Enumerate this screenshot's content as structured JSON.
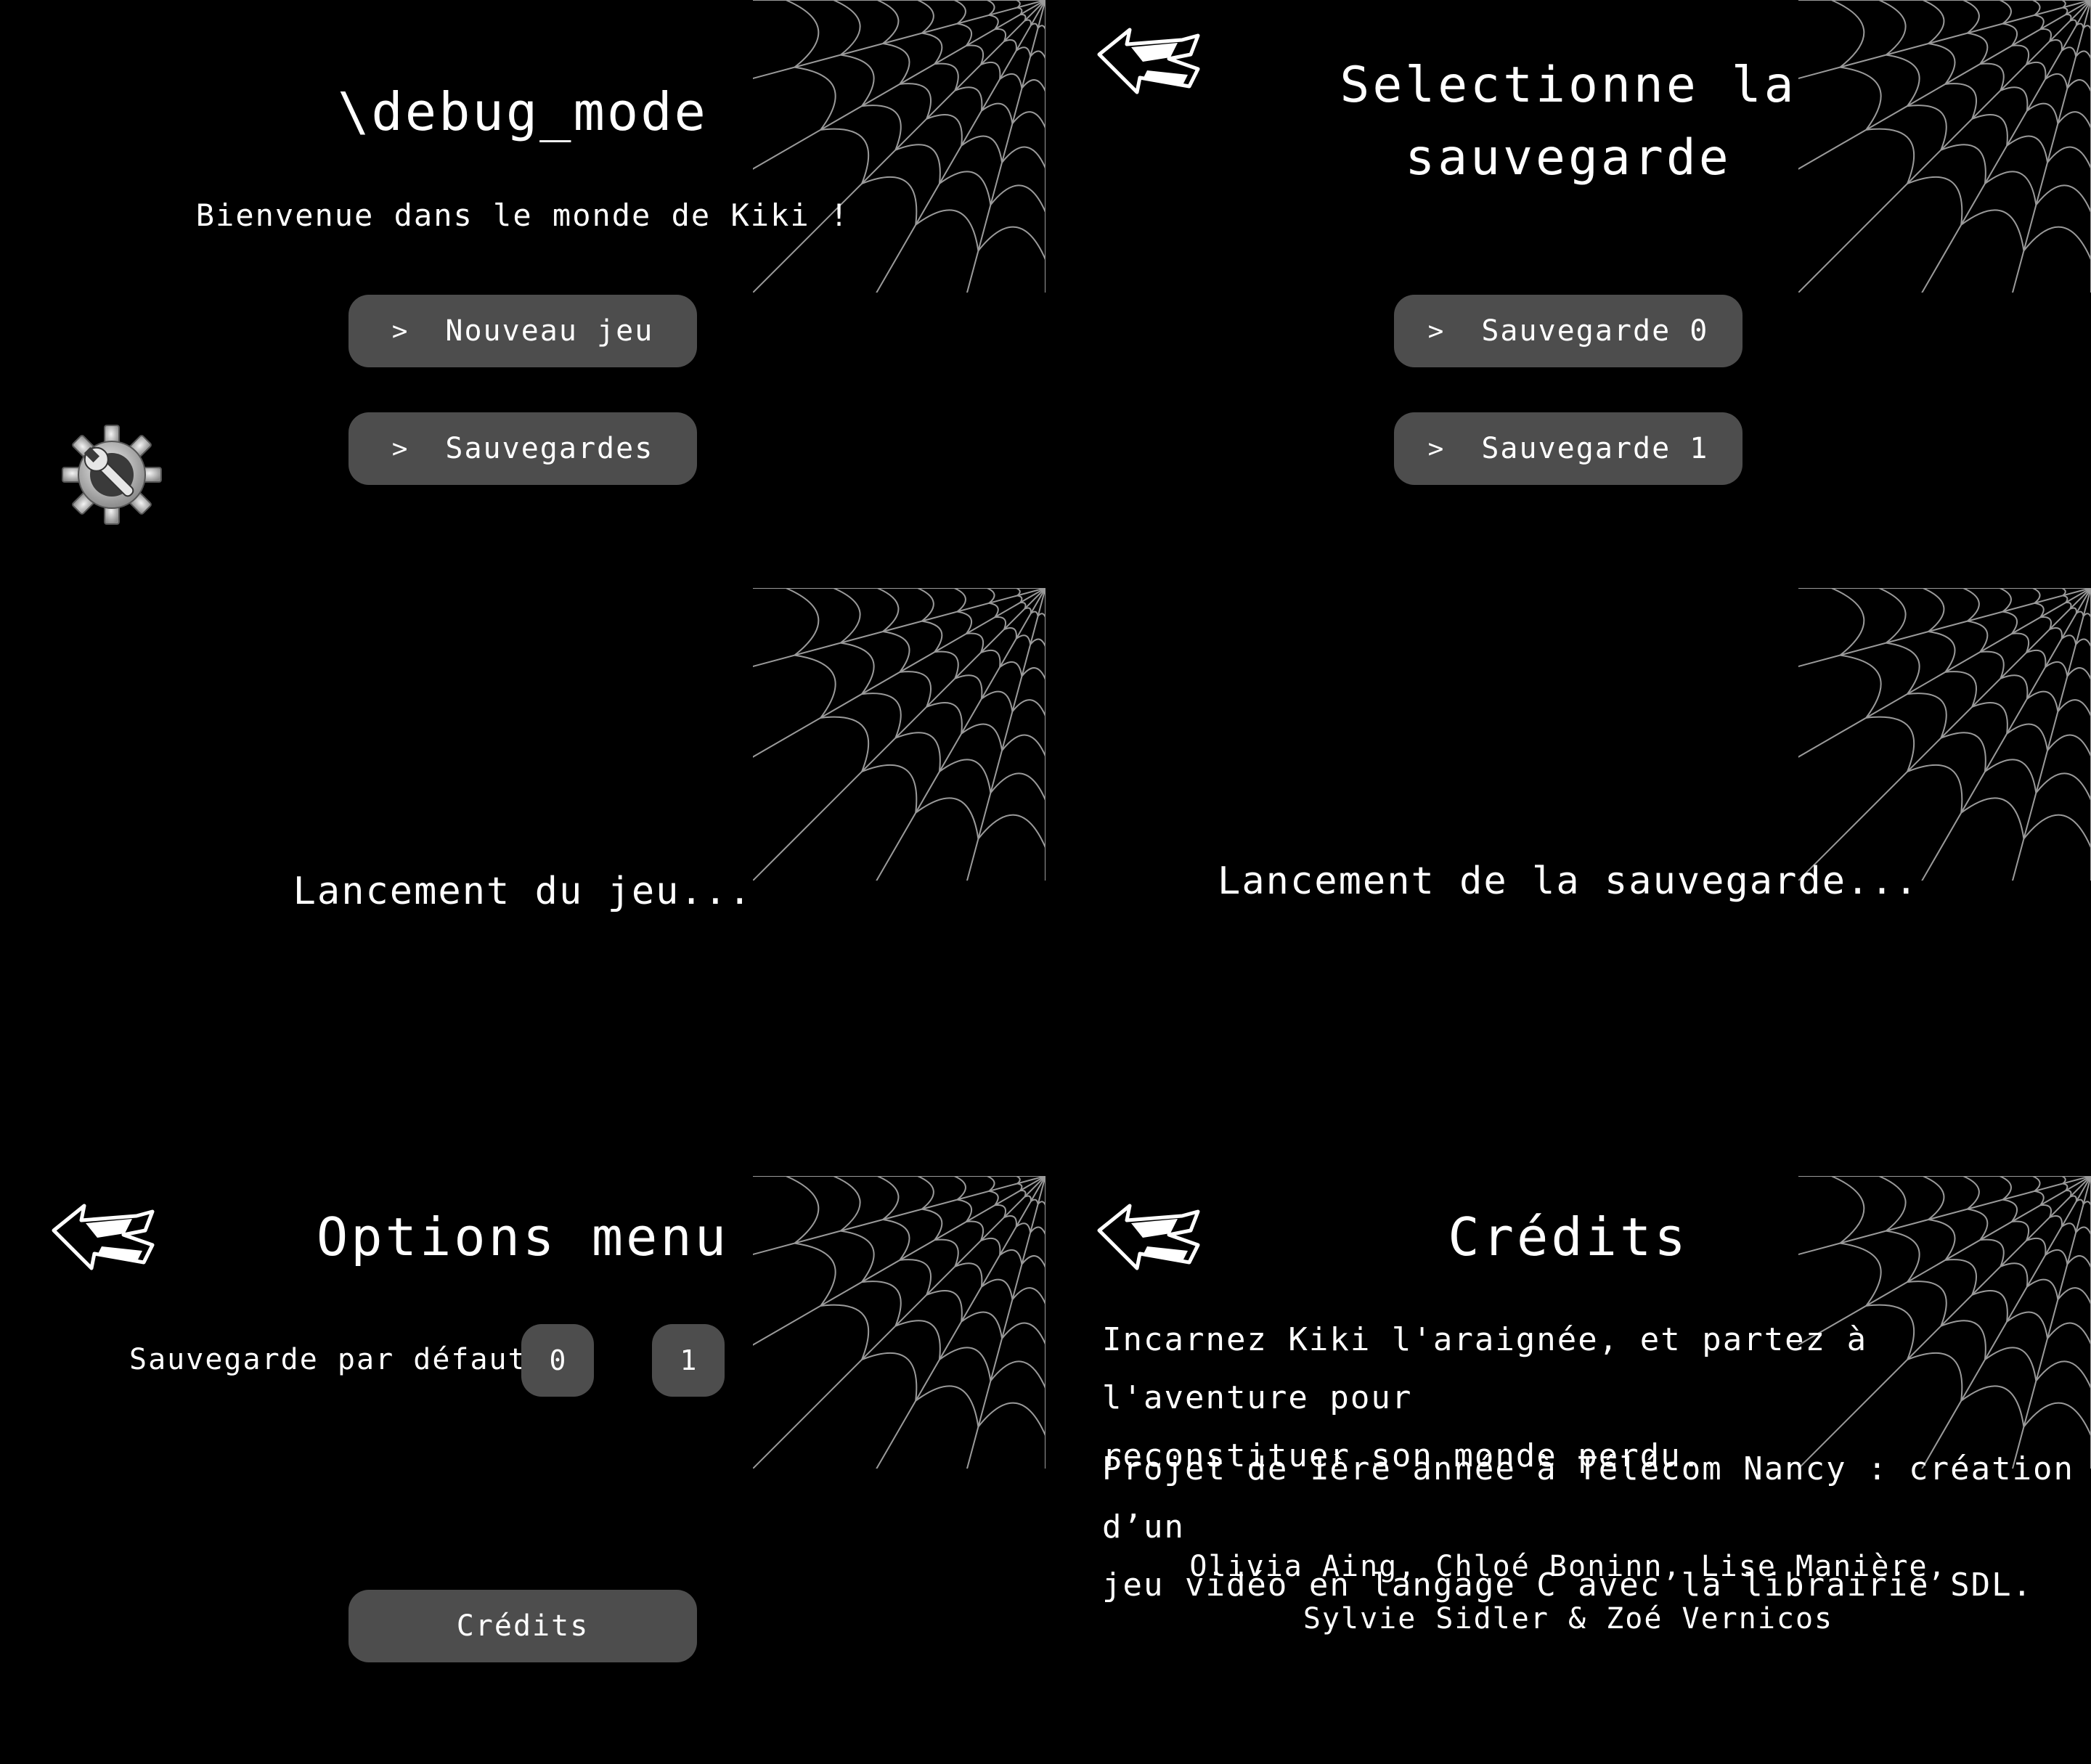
{
  "colors": {
    "background": "#000000",
    "button": "#4d4d4d",
    "text": "#ffffff",
    "web_stroke": "#9a9a9a"
  },
  "icons": {
    "settings": "gear-wrench-icon",
    "back": "back-arrow-icon",
    "decoration": "spiderweb-icon"
  },
  "main_menu": {
    "title": "\\debug_mode",
    "subtitle": "Bienvenue dans le monde de Kiki !",
    "chevron": ">",
    "new_game": "Nouveau jeu",
    "saves": "Sauvegardes"
  },
  "save_select": {
    "title_line1": "Selectionne la",
    "title_line2": "sauvegarde",
    "chevron": ">",
    "save0": "Sauvegarde 0",
    "save1": "Sauvegarde 1"
  },
  "loading_game": {
    "text": "Lancement du jeu..."
  },
  "loading_save": {
    "text": "Lancement de la sauvegarde..."
  },
  "options": {
    "title": "Options menu",
    "default_save_label": "Sauvegarde par défaut:",
    "opt0": "0",
    "opt1": "1",
    "credits_button": "Crédits"
  },
  "credits": {
    "title": "Crédits",
    "para1_line1": "Incarnez Kiki l'araignée, et partez à l'aventure pour",
    "para1_line2": "reconstituer son monde perdu.",
    "para2_line1": "Projet de 1ère année à Télécom Nancy : création d’un",
    "para2_line2": "jeu vidéo en langage C avec la librairie SDL.",
    "authors_line1": "Olivia Aing, Chloé Boninn, Lise Manière,",
    "authors_line2": "Sylvie Sidler & Zoé Vernicos"
  }
}
